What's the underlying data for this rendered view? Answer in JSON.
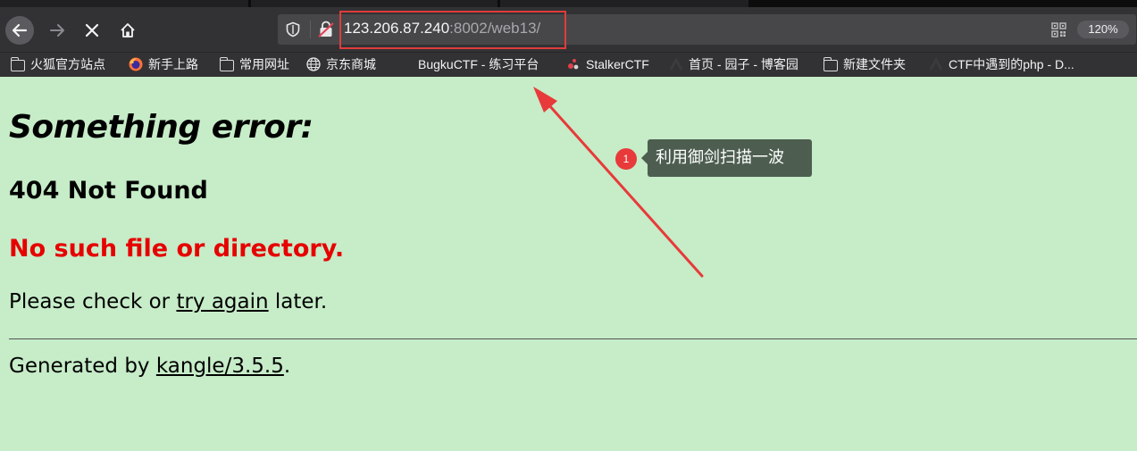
{
  "browser": {
    "url_host": "123.206.87.240",
    "url_rest": ":8002/web13/",
    "zoom": "120%",
    "colors": {
      "highlight": "#e03c3c",
      "toolbar": "#323234"
    }
  },
  "bookmarks": [
    {
      "label": "火狐官方站点",
      "icon": "folder-icon"
    },
    {
      "label": "新手上路",
      "icon": "firefox-icon"
    },
    {
      "label": "常用网址",
      "icon": "folder-icon"
    },
    {
      "label": "京东商城",
      "icon": "globe-icon"
    },
    {
      "label": "BugkuCTF - 练习平台",
      "icon": "none"
    },
    {
      "label": "StalkerCTF",
      "icon": "stalker-icon"
    },
    {
      "label": "首页 - 园子 - 博客园",
      "icon": "cnblogs-icon"
    },
    {
      "label": "新建文件夹",
      "icon": "folder-icon"
    },
    {
      "label": "CTF中遇到的php - D...",
      "icon": "cnblogs-icon"
    }
  ],
  "page": {
    "title": "Something error:",
    "status": "404 Not Found",
    "error": "No such file or directory.",
    "check_before": "Please check or ",
    "check_link": "try again",
    "check_after": " later.",
    "gen_before": "Generated by ",
    "gen_link": "kangle/3.5.5",
    "gen_after": ".",
    "background": "#c6ecc8",
    "error_color": "#e60000"
  },
  "annotation": {
    "number": "1",
    "text": "利用御剑扫描一波",
    "color": "#e83a3a"
  }
}
